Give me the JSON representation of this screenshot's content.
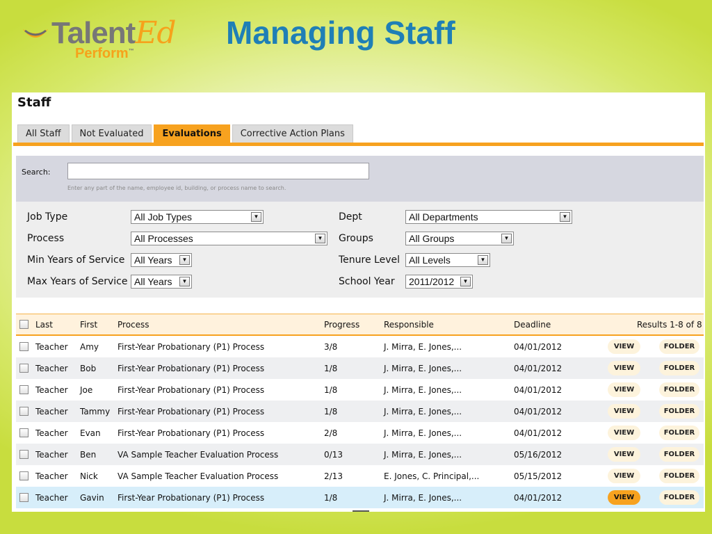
{
  "logo": {
    "main": "Talent",
    "accent": "Ed",
    "sub": "Perform",
    "tm": "™"
  },
  "slide_title": "Managing Staff",
  "panel_title": "Staff",
  "tabs": [
    {
      "label": "All Staff",
      "active": false
    },
    {
      "label": "Not Evaluated",
      "active": false
    },
    {
      "label": "Evaluations",
      "active": true
    },
    {
      "label": "Corrective Action Plans",
      "active": false
    }
  ],
  "search": {
    "label": "Search:",
    "value": "",
    "hint": "Enter any part of the name, employee id, building, or process name to search."
  },
  "filters": {
    "job_type": {
      "label": "Job Type",
      "value": "All Job Types"
    },
    "process": {
      "label": "Process",
      "value": "All Processes"
    },
    "min_years": {
      "label": "Min Years of Service",
      "value": "All Years"
    },
    "max_years": {
      "label": "Max Years of Service",
      "value": "All Years"
    },
    "dept": {
      "label": "Dept",
      "value": "All Departments"
    },
    "groups": {
      "label": "Groups",
      "value": "All Groups"
    },
    "tenure": {
      "label": "Tenure Level",
      "value": "All Levels"
    },
    "school_year": {
      "label": "School Year",
      "value": "2011/2012"
    }
  },
  "table": {
    "headers": {
      "last": "Last",
      "first": "First",
      "process": "Process",
      "progress": "Progress",
      "responsible": "Responsible",
      "deadline": "Deadline",
      "results": "Results 1-8 of 8"
    },
    "view_label": "VIEW",
    "folder_label": "FOLDER",
    "rows": [
      {
        "last": "Teacher",
        "first": "Amy",
        "process": "First-Year Probationary (P1) Process",
        "progress": "3/8",
        "responsible": "J. Mirra, E. Jones,...",
        "deadline": "04/01/2012"
      },
      {
        "last": "Teacher",
        "first": "Bob",
        "process": "First-Year Probationary (P1) Process",
        "progress": "1/8",
        "responsible": "J. Mirra, E. Jones,...",
        "deadline": "04/01/2012"
      },
      {
        "last": "Teacher",
        "first": "Joe",
        "process": "First-Year Probationary (P1) Process",
        "progress": "1/8",
        "responsible": "J. Mirra, E. Jones,...",
        "deadline": "04/01/2012"
      },
      {
        "last": "Teacher",
        "first": "Tammy",
        "process": "First-Year Probationary (P1) Process",
        "progress": "1/8",
        "responsible": "J. Mirra, E. Jones,...",
        "deadline": "04/01/2012"
      },
      {
        "last": "Teacher",
        "first": "Evan",
        "process": "First-Year Probationary (P1) Process",
        "progress": "2/8",
        "responsible": "J. Mirra, E. Jones,...",
        "deadline": "04/01/2012"
      },
      {
        "last": "Teacher",
        "first": "Ben",
        "process": "VA Sample Teacher Evaluation Process",
        "progress": "0/13",
        "responsible": "J. Mirra, E. Jones,...",
        "deadline": "05/16/2012"
      },
      {
        "last": "Teacher",
        "first": "Nick",
        "process": "VA Sample Teacher Evaluation Process",
        "progress": "2/13",
        "responsible": "E. Jones, C. Principal,...",
        "deadline": "05/15/2012"
      },
      {
        "last": "Teacher",
        "first": "Gavin",
        "process": "First-Year Probationary (P1) Process",
        "progress": "1/8",
        "responsible": "J. Mirra, E. Jones,...",
        "deadline": "04/01/2012"
      }
    ]
  },
  "colors": {
    "accent": "#f7a21f",
    "title": "#1f7fb6",
    "highlight_row": "#d7eefa"
  }
}
